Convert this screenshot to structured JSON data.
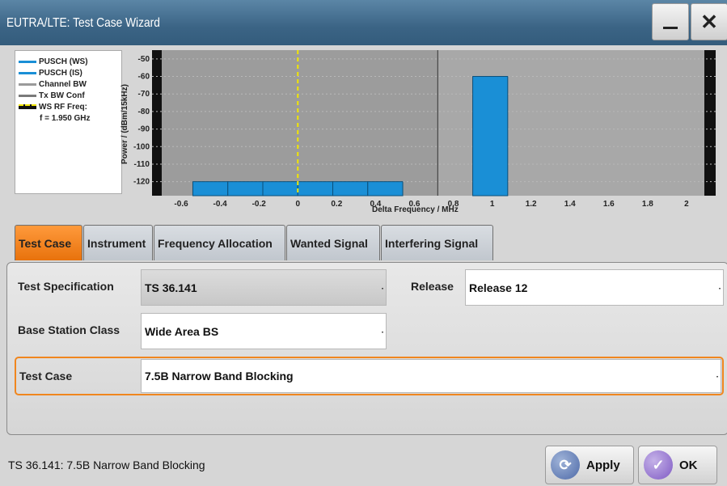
{
  "window": {
    "title": "EUTRA/LTE: Test Case Wizard",
    "close_symbol": "✕"
  },
  "graph": {
    "ylabel": "Power / (dBm/15kHz)",
    "xlabel": "Delta Frequency / MHz",
    "y_ticks": [
      "-50",
      "-60",
      "-70",
      "-80",
      "-90",
      "-100",
      "-110",
      "-120"
    ],
    "x_ticks": [
      "-0.6",
      "-0.4",
      "-0.2",
      "0",
      "0.2",
      "0.4",
      "0.6",
      "0.8",
      "1",
      "1.2",
      "1.4",
      "1.6",
      "1.8",
      "2"
    ],
    "legend": [
      {
        "label": "PUSCH (WS)",
        "color": "#1a8fd6"
      },
      {
        "label": "PUSCH (IS)",
        "color": "#1a8fd6"
      },
      {
        "label": "Channel BW",
        "color": "#9a9a9a"
      },
      {
        "label": "Tx BW Conf",
        "color": "#7a7a7a"
      },
      {
        "label": "WS RF Freq:",
        "color": "#f2e600"
      },
      {
        "label": "f = 1.950 GHz",
        "color": ""
      }
    ]
  },
  "chart_data": {
    "type": "bar",
    "xlabel": "Delta Frequency / MHz",
    "ylabel": "Power / (dBm/15kHz)",
    "xlim": [
      -0.75,
      2.15
    ],
    "ylim": [
      -128,
      -45
    ],
    "series": [
      {
        "name": "PUSCH (WS)",
        "bars": [
          [
            -0.54,
            -0.36,
            -120
          ],
          [
            -0.36,
            -0.18,
            -120
          ],
          [
            -0.18,
            0.0,
            -120
          ],
          [
            0.0,
            0.18,
            -120
          ],
          [
            0.18,
            0.36,
            -120
          ],
          [
            0.36,
            0.54,
            -120
          ]
        ]
      },
      {
        "name": "PUSCH (IS)",
        "bars": [
          [
            0.9,
            1.08,
            -60
          ]
        ]
      }
    ],
    "ws_rf_freq_marker_x": 0,
    "divider_x": 0.72
  },
  "tabs": [
    {
      "label": "Test Case",
      "active": true
    },
    {
      "label": "Instrument",
      "active": false
    },
    {
      "label": "Frequency Allocation",
      "active": false
    },
    {
      "label": "Wanted Signal",
      "active": false
    },
    {
      "label": "Interfering Signal",
      "active": false
    }
  ],
  "form": {
    "test_spec_label": "Test Specification",
    "test_spec_value": "TS 36.141",
    "release_label": "Release",
    "release_value": "Release 12",
    "bs_class_label": "Base Station Class",
    "bs_class_value": "Wide Area BS",
    "test_case_label": "Test Case",
    "test_case_value": "7.5B  Narrow Band Blocking",
    "dropdown_marker": "·"
  },
  "status_text": "TS 36.141:  7.5B  Narrow Band Blocking",
  "buttons": {
    "apply": "Apply",
    "ok": "OK"
  }
}
